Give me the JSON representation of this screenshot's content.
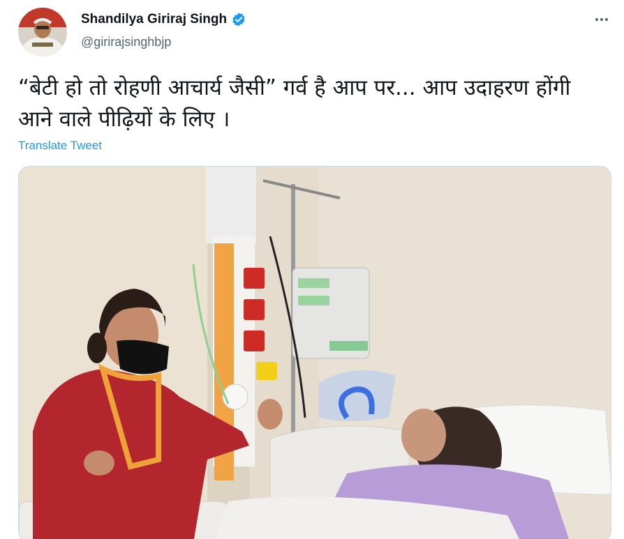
{
  "author": {
    "display_name": "Shandilya Giriraj Singh",
    "handle": "@girirajsinghbjp",
    "verified_icon": "verified-badge-icon",
    "avatar_icon": "profile-photo"
  },
  "tweet": {
    "text": "“बेटी हो तो रोहणी आचार्य जैसी” गर्व है आप पर... आप उदाहरण होंगी आने वाले पीढ़ियों के लिए ।",
    "translate_label": "Translate Tweet",
    "more_icon": "more-options-icon"
  },
  "media": {
    "description_icon": "hospital-room-photo"
  },
  "colors": {
    "link": "#1d9bf0",
    "verified": "#1d9bf0",
    "secondary_text": "#536471",
    "primary_text": "#0f1419"
  }
}
